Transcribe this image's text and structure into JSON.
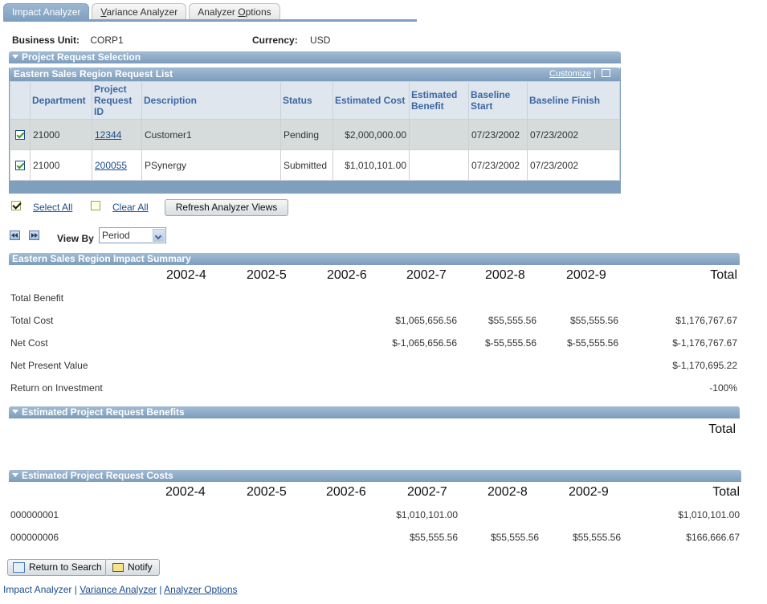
{
  "tabs": [
    {
      "label": "Impact Analyzer",
      "active": true
    },
    {
      "label": "Variance Analyzer",
      "active": false,
      "accesskey_pre": "",
      "accesskey": "V",
      "accesskey_post": "ariance Analyzer"
    },
    {
      "label": "Analyzer Options",
      "active": false,
      "accesskey_pre": "Analyzer ",
      "accesskey": "O",
      "accesskey_post": "ptions"
    }
  ],
  "header": {
    "business_unit_label": "Business Unit:",
    "business_unit": "CORP1",
    "currency_label": "Currency:",
    "currency": "USD"
  },
  "selection_section": {
    "title": "Project Request Selection"
  },
  "grid": {
    "title": "Eastern Sales Region Request List",
    "customize": "Customize",
    "separator": "|",
    "columns": [
      "",
      "Department",
      "Project Request ID",
      "Description",
      "Status",
      "Estimated Cost",
      "Estimated Benefit",
      "Baseline Start",
      "Baseline Finish"
    ],
    "rows": [
      {
        "checked": true,
        "department": "21000",
        "request_id": "12344",
        "description": "Customer1",
        "status": "Pending",
        "est_cost": "$2,000,000.00",
        "est_benefit": "",
        "baseline_start": "07/23/2002",
        "baseline_finish": "07/23/2002"
      },
      {
        "checked": true,
        "department": "21000",
        "request_id": "200055",
        "description": "PSynergy",
        "status": "Submitted",
        "est_cost": "$1,010,101.00",
        "est_benefit": "",
        "baseline_start": "07/23/2002",
        "baseline_finish": "07/23/2002"
      }
    ]
  },
  "actions": {
    "select_all": "Select All",
    "clear_all": "Clear All",
    "refresh": "Refresh Analyzer Views",
    "view_by_label": "View By",
    "view_by_value": "Period"
  },
  "impact_summary": {
    "title": "Eastern Sales Region Impact Summary",
    "periods": [
      "2002-4",
      "2002-5",
      "2002-6",
      "2002-7",
      "2002-8",
      "2002-9"
    ],
    "total_label": "Total",
    "rows": [
      {
        "label": "Total Benefit",
        "values": [
          "",
          "",
          "",
          "",
          "",
          ""
        ],
        "total": ""
      },
      {
        "label": "Total Cost",
        "values": [
          "",
          "",
          "",
          "$1,065,656.56",
          "$55,555.56",
          "$55,555.56"
        ],
        "total": "$1,176,767.67"
      },
      {
        "label": "Net Cost",
        "values": [
          "",
          "",
          "",
          "$-1,065,656.56",
          "$-55,555.56",
          "$-55,555.56"
        ],
        "total": "$-1,176,767.67"
      },
      {
        "label": "Net Present Value",
        "values": [
          "",
          "",
          "",
          "",
          "",
          ""
        ],
        "total": "$-1,170,695.22"
      },
      {
        "label": "Return on Investment",
        "values": [
          "",
          "",
          "",
          "",
          "",
          ""
        ],
        "total": "-100%"
      }
    ]
  },
  "benefits": {
    "title": "Estimated Project Request Benefits",
    "total_label": "Total"
  },
  "costs": {
    "title": "Estimated Project Request Costs",
    "periods": [
      "2002-4",
      "2002-5",
      "2002-6",
      "2002-7",
      "2002-8",
      "2002-9"
    ],
    "total_label": "Total",
    "rows": [
      {
        "label": "000000001",
        "values": [
          "",
          "",
          "",
          "$1,010,101.00",
          "",
          ""
        ],
        "total": "$1,010,101.00"
      },
      {
        "label": "000000006",
        "values": [
          "",
          "",
          "",
          "$55,555.56",
          "$55,555.56",
          "$55,555.56"
        ],
        "total": "$166,666.67"
      }
    ]
  },
  "buttons": {
    "return_to_search": "Return to Search",
    "notify": "Notify"
  },
  "footer_links": [
    {
      "label": "Impact Analyzer",
      "link": false
    },
    {
      "label": "Variance Analyzer",
      "link": true
    },
    {
      "label": "Analyzer Options",
      "link": true
    }
  ],
  "footer_separator": "|"
}
